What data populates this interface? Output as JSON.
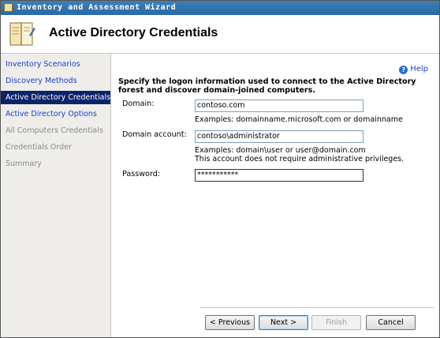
{
  "window": {
    "title": "Inventory and Assessment Wizard"
  },
  "header": {
    "title": "Active Directory Credentials"
  },
  "sidebar": {
    "items": [
      {
        "label": "Inventory Scenarios",
        "state": "link"
      },
      {
        "label": "Discovery Methods",
        "state": "link"
      },
      {
        "label": "Active Directory Credentials",
        "state": "active"
      },
      {
        "label": "Active Directory Options",
        "state": "link"
      },
      {
        "label": "All Computers Credentials",
        "state": "disabled"
      },
      {
        "label": "Credentials Order",
        "state": "disabled"
      },
      {
        "label": "Summary",
        "state": "disabled"
      }
    ]
  },
  "content": {
    "help_label": "Help",
    "instruction": "Specify the logon information used to connect to the Active Directory forest and discover domain-joined computers.",
    "domain": {
      "label": "Domain:",
      "value": "contoso.com",
      "hint": "Examples: domainname.microsoft.com or domainname"
    },
    "account": {
      "label": "Domain account:",
      "value": "contoso\\administrator",
      "hint_line1": "Examples: domain\\user or user@domain.com",
      "hint_line2": "This account does not require administrative privileges."
    },
    "password": {
      "label": "Password:",
      "value": "***********"
    }
  },
  "footer": {
    "previous_label": "< Previous",
    "next_label": "Next >",
    "finish_label": "Finish",
    "cancel_label": "Cancel"
  },
  "icons": {
    "app": "wizard-book-icon",
    "help": "help-icon"
  }
}
